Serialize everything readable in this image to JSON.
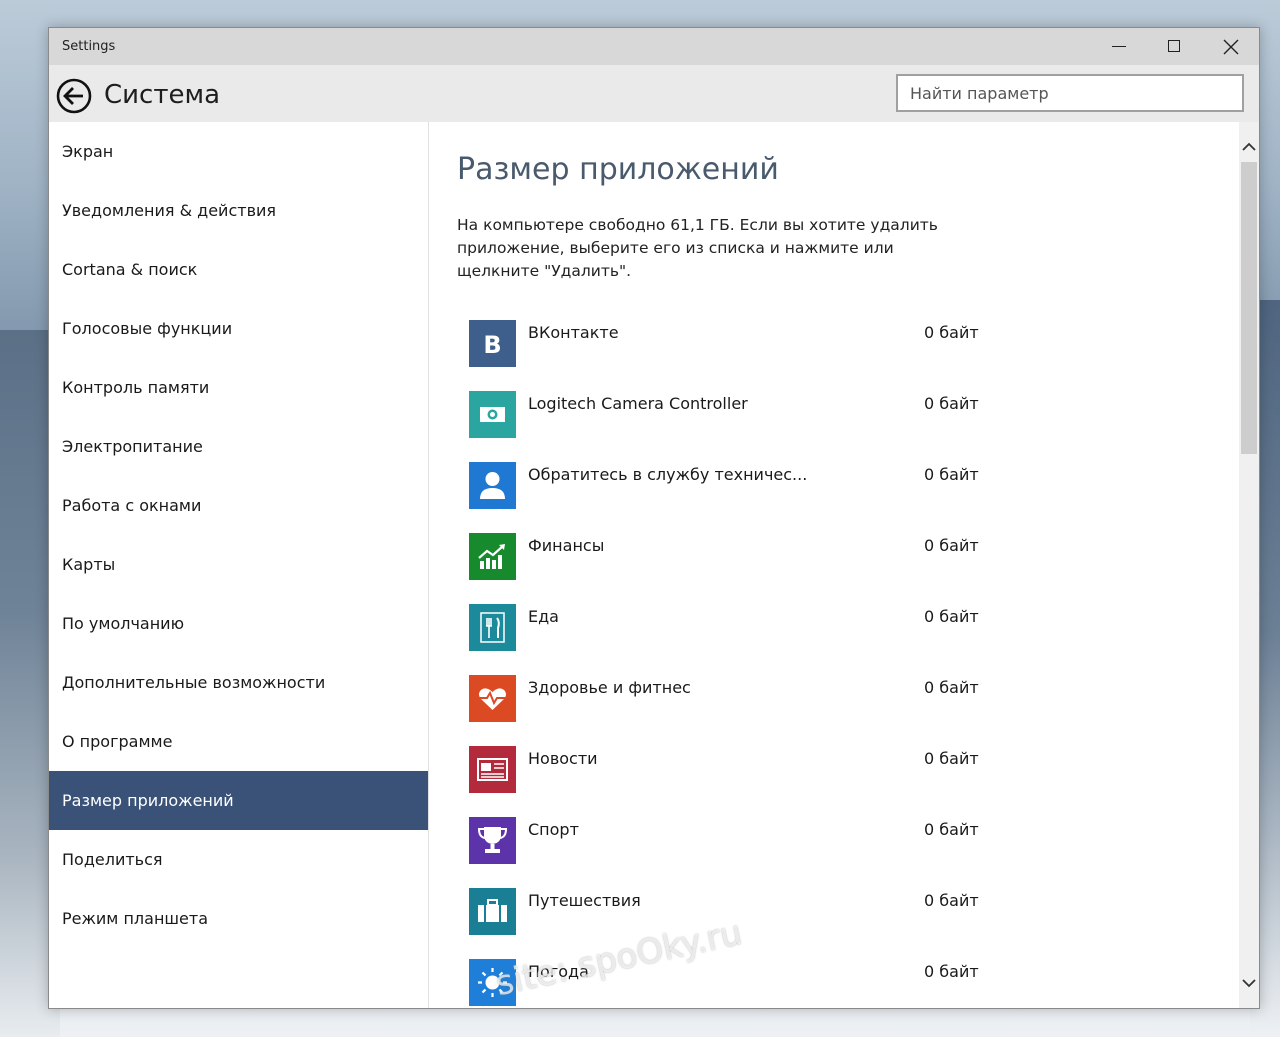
{
  "window": {
    "title": "Settings"
  },
  "header": {
    "title": "Система",
    "search_placeholder": "Найти параметр"
  },
  "sidebar": {
    "items": [
      {
        "label": "Экран"
      },
      {
        "label": "Уведомления & действия"
      },
      {
        "label": "Cortana & поиск"
      },
      {
        "label": "Голосовые функции"
      },
      {
        "label": "Контроль памяти"
      },
      {
        "label": "Электропитание"
      },
      {
        "label": "Работа с окнами"
      },
      {
        "label": "Карты"
      },
      {
        "label": "По умолчанию"
      },
      {
        "label": "Дополнительные возможности"
      },
      {
        "label": "О программе"
      },
      {
        "label": "Размер приложений"
      },
      {
        "label": "Поделиться"
      },
      {
        "label": "Режим планшета"
      }
    ],
    "active": "Размер приложений"
  },
  "main": {
    "heading": "Размер приложений",
    "description": "На компьютере свободно 61,1 ГБ. Если вы хотите удалить приложение, выберите его из списка и нажмите или щелкните \"Удалить\".",
    "apps": [
      {
        "name": "ВКонтакте",
        "size": "0 байт",
        "color": "#3e5e8c",
        "icon": "vk-logo-icon"
      },
      {
        "name": "Logitech Camera Controller",
        "size": "0 байт",
        "color": "#2aa59f",
        "icon": "camera-icon"
      },
      {
        "name": "Обратитесь в службу техничес...",
        "size": "0 байт",
        "color": "#1f79d2",
        "icon": "support-person-icon"
      },
      {
        "name": "Финансы",
        "size": "0 байт",
        "color": "#168a2c",
        "icon": "finance-chart-icon"
      },
      {
        "name": "Еда",
        "size": "0 байт",
        "color": "#1b8b9c",
        "icon": "fork-knife-icon"
      },
      {
        "name": "Здоровье и фитнес",
        "size": "0 байт",
        "color": "#dc4a24",
        "icon": "heart-pulse-icon"
      },
      {
        "name": "Новости",
        "size": "0 байт",
        "color": "#b22a3c",
        "icon": "newspaper-icon"
      },
      {
        "name": "Спорт",
        "size": "0 байт",
        "color": "#5c33a8",
        "icon": "trophy-icon"
      },
      {
        "name": "Путешествия",
        "size": "0 байт",
        "color": "#1a7f95",
        "icon": "suitcase-icon"
      },
      {
        "name": "Погода",
        "size": "0 байт",
        "color": "#1f7fd8",
        "icon": "sun-icon"
      }
    ]
  },
  "watermark": "site: spoOky.ru"
}
